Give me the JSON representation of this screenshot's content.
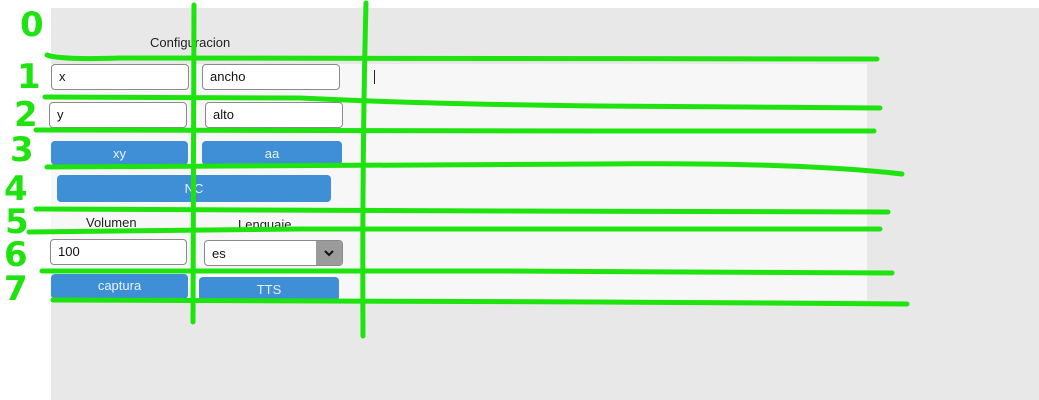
{
  "config": {
    "title": "Configuracion",
    "x_field": {
      "value": "x"
    },
    "ancho_field": {
      "value": "ancho"
    },
    "y_field": {
      "value": "y"
    },
    "alto_field": {
      "value": "alto"
    },
    "xy_button": "xy",
    "aa_button": "aa",
    "wide_button": "NC"
  },
  "audio": {
    "volumen_label": "Volumen",
    "volumen_value": "100",
    "lenguaje_label": "Lenguaje",
    "lenguaje_selected": "es",
    "captura_button": "captura",
    "tts_button": "TTS"
  },
  "annotations": {
    "row_labels": [
      "0",
      "1",
      "2",
      "3",
      "4",
      "5",
      "6",
      "7"
    ],
    "color": "#1fe30f"
  },
  "colors": {
    "button": "#3f8fd6",
    "panel": "#f7f7f7",
    "canvas": "#e8e8e8"
  }
}
